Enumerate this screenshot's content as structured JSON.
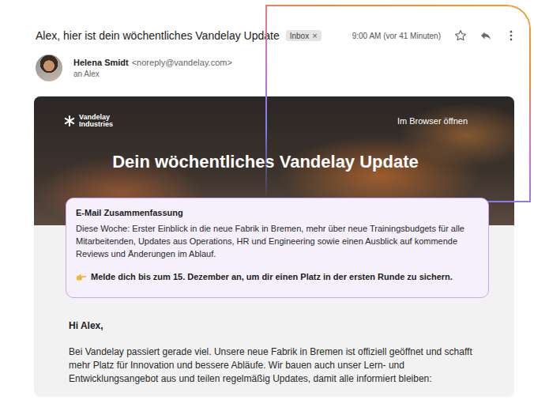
{
  "email": {
    "subject": "Alex, hier ist dein wöchentliches Vandelay Update",
    "label": {
      "text": "Inbox",
      "close": "×"
    },
    "time": "9:00 AM (vor 41 Minuten)",
    "starred": false
  },
  "sender": {
    "name": "Helena Smidt",
    "address": "<noreply@vandelay.com>",
    "recipient": "an Alex"
  },
  "newsletter": {
    "logo": [
      "Vandelay",
      "Industries"
    ],
    "browser_link": "Im Browser öffnen",
    "title": "Dein wöchentliches Vandelay Update"
  },
  "summary": {
    "title": "E-Mail Zusammenfassung",
    "text": "Diese Woche: Erster Einblick in die neue Fabrik in Bremen, mehr über neue Trainingsbudgets für alle Mitarbeitenden, Updates aus Operations, HR und Engineering sowie einen Ausblick auf kommende Reviews und Änderungen im Ablauf.",
    "call_to_action": "Melde dich bis zum 15. Dezember an, um dir einen Platz in der ersten Runde zu sichern."
  },
  "body": {
    "greeting": "Hi Alex,",
    "paragraph": "Bei Vandelay passiert gerade viel. Unsere neue Fabrik in Bremen ist offiziell geöffnet und schafft mehr Platz für Innovation und bessere Abläufe. Wir bauen auch unser Lern- und Entwicklungsangebot aus und teilen regelmäßig Updates, damit alle informiert bleiben:"
  }
}
